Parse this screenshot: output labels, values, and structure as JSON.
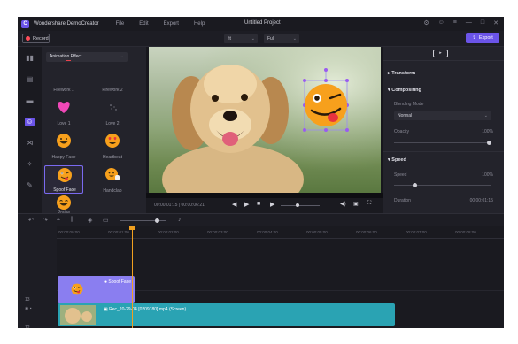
{
  "titlebar": {
    "app_name": "Wondershare DemoCreator",
    "menu": [
      "File",
      "Edit",
      "Export",
      "Help"
    ],
    "project_title": "Untitled Project",
    "win_controls": [
      "⚙",
      "☺",
      "≡",
      "—",
      "□",
      "✕"
    ]
  },
  "toolbar": {
    "record_label": "Record",
    "ratio_select": "fit",
    "quality_select": "Full",
    "export_label": "Export"
  },
  "effects_panel": {
    "category": "Animation Effect",
    "items": [
      {
        "label": "Firework 1",
        "icon": "firework-icon"
      },
      {
        "label": "Firework 2",
        "icon": "firework-icon"
      },
      {
        "label": "Love 1",
        "icon": "heart-icon"
      },
      {
        "label": "Love 2",
        "icon": "sparkle-icon"
      },
      {
        "label": "Happy Face",
        "icon": "happy-face-icon"
      },
      {
        "label": "Heartbeat",
        "icon": "heart-eyes-icon"
      },
      {
        "label": "Spoof Face",
        "icon": "spoof-face-icon"
      },
      {
        "label": "Handclap",
        "icon": "handclap-icon"
      },
      {
        "label": "Praise",
        "icon": "praise-icon"
      }
    ],
    "selected_index": 6
  },
  "preview": {
    "time_display": "00:00:01:15 | 00:00:06:21",
    "controls": [
      "◀",
      "▶",
      "■",
      "▶"
    ],
    "right_controls": [
      "◀)",
      "▣",
      "⛶"
    ]
  },
  "properties": {
    "sections": {
      "transform": "Transform",
      "compositing": "Compositing",
      "speed": "Speed"
    },
    "blending_mode_label": "Blending Mode",
    "blending_mode_value": "Normal",
    "opacity_label": "Opacity",
    "opacity_value": "100%",
    "opacity_level": 1.0,
    "speed_label": "Speed",
    "speed_value": "100%",
    "speed_level": 0.2,
    "duration_label": "Duration",
    "duration_value": "00:00:01:15"
  },
  "timeline": {
    "ruler_labels": [
      "00:00:00:00",
      "00:00:01:00",
      "00:00:02:00",
      "00:00:03:00",
      "00:00:04:00",
      "00:00:05:00",
      "00:00:06:00",
      "00:00:07:00",
      "00:00:08:00"
    ],
    "tracks": [
      {
        "number": "13"
      },
      {
        "number": "12"
      }
    ],
    "effect_clip_label": "Spoof Face",
    "video_clip_label": "Rec_20-29-04 [0209180].mp4 (Screen)"
  },
  "colors": {
    "accent": "#6b54e8",
    "record_dot": "#ff4d5a",
    "effect_clip": "#8a7ef0",
    "video_clip": "#2aa3b3",
    "playhead": "#f0a020"
  }
}
